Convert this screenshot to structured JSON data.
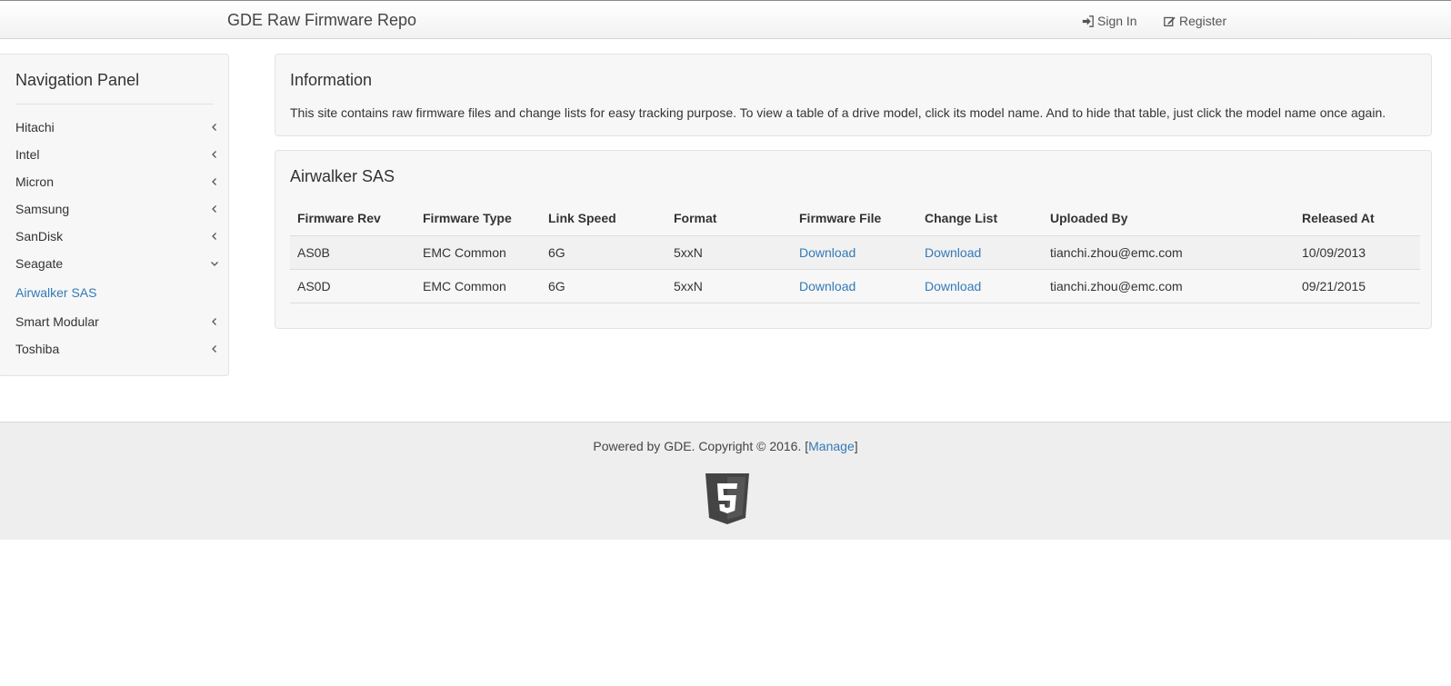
{
  "navbar": {
    "brand": "GDE Raw Firmware Repo",
    "sign_in": "Sign In",
    "register": "Register"
  },
  "sidebar": {
    "title": "Navigation Panel",
    "items": [
      {
        "label": "Hitachi",
        "state": "collapsed"
      },
      {
        "label": "Intel",
        "state": "collapsed"
      },
      {
        "label": "Micron",
        "state": "collapsed"
      },
      {
        "label": "Samsung",
        "state": "collapsed"
      },
      {
        "label": "SanDisk",
        "state": "collapsed"
      },
      {
        "label": "Seagate",
        "state": "expanded"
      },
      {
        "label": "Airwalker SAS",
        "state": "active-subitem"
      },
      {
        "label": "Smart Modular",
        "state": "collapsed"
      },
      {
        "label": "Toshiba",
        "state": "collapsed"
      }
    ]
  },
  "info": {
    "title": "Information",
    "text": "This site contains raw firmware files and change lists for easy tracking purpose. To view a table of a drive model, click its model name. And to hide that table, just click the model name once again."
  },
  "model": {
    "title": "Airwalker SAS",
    "columns": [
      "Firmware Rev",
      "Firmware Type",
      "Link Speed",
      "Format",
      "Firmware File",
      "Change List",
      "Uploaded By",
      "Released At"
    ],
    "rows": [
      [
        "AS0B",
        "EMC Common",
        "6G",
        "5xxN",
        "Download",
        "Download",
        "tianchi.zhou@emc.com",
        "10/09/2013"
      ],
      [
        "AS0D",
        "EMC Common",
        "6G",
        "5xxN",
        "Download",
        "Download",
        "tianchi.zhou@emc.com",
        "09/21/2015"
      ]
    ]
  },
  "footer": {
    "text": "Powered by GDE. Copyright © 2016. [",
    "manage": "Manage",
    "close_bracket": "]",
    "logo_icon": "html5-logo-icon"
  },
  "colors": {
    "link": "#337ab7",
    "panel_bg": "#f7f7f7",
    "footer_bg": "#eeeeee"
  }
}
